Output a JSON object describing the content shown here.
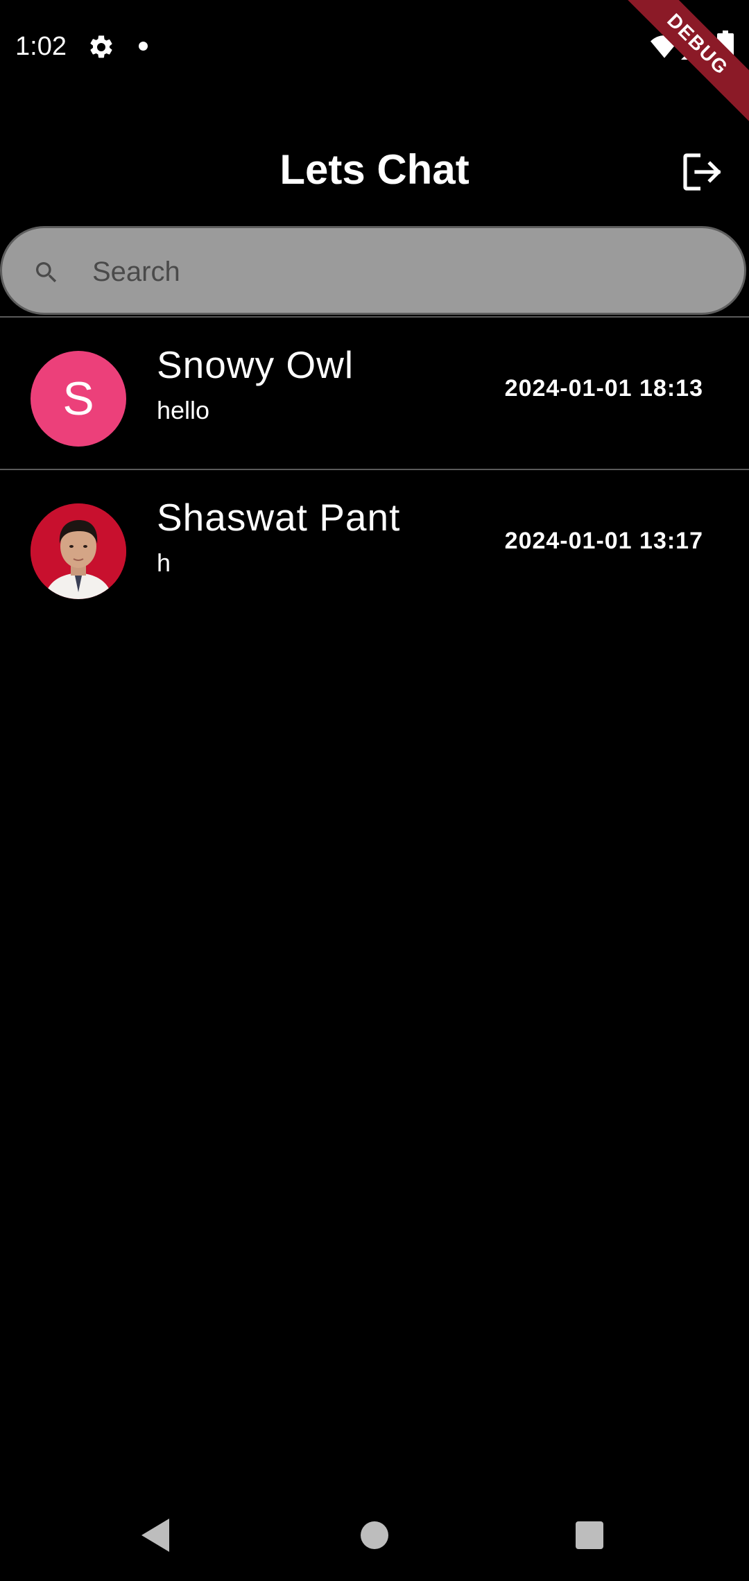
{
  "status_bar": {
    "time": "1:02",
    "icons": [
      "gear-icon",
      "notification-dot",
      "wifi-icon",
      "signal-icon",
      "battery-icon"
    ]
  },
  "debug_banner": "DEBUG",
  "app_bar": {
    "title": "Lets Chat",
    "action_icon": "logout-icon"
  },
  "search": {
    "placeholder": "Search",
    "value": "",
    "icon": "search-icon"
  },
  "chats": [
    {
      "name": "Snowy Owl",
      "last_message": "hello",
      "timestamp": "2024-01-01 18:13",
      "avatar_type": "letter",
      "avatar_letter": "S",
      "avatar_color": "#ec407a"
    },
    {
      "name": "Shaswat Pant",
      "last_message": "h",
      "timestamp": "2024-01-01 13:17",
      "avatar_type": "photo"
    }
  ],
  "nav_bar": {
    "icons": [
      "back-icon",
      "home-icon",
      "recents-icon"
    ]
  },
  "colors": {
    "background": "#000000",
    "search_fill": "#9b9b9b",
    "debug_ribbon": "#8b1a27"
  }
}
